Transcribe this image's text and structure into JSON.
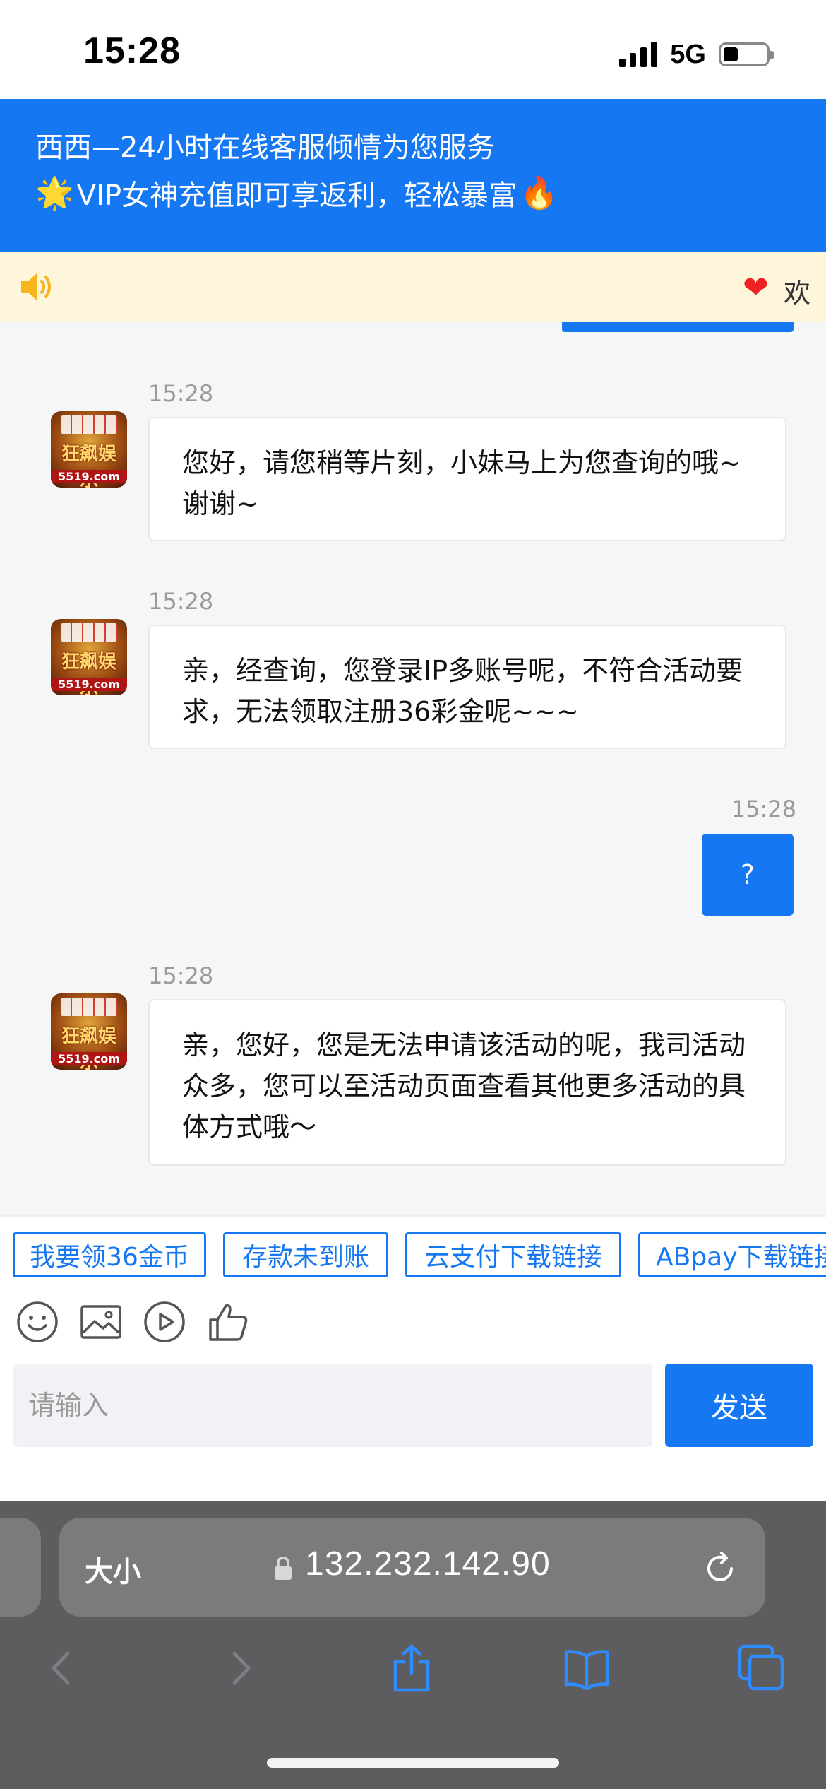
{
  "status_bar": {
    "time": "15:28",
    "network": "5G"
  },
  "header": {
    "title": "西西—24小时在线客服倾情为您服务",
    "promo_text": "VIP女神充值即可享返利，轻松暴富",
    "star_icon": "star-icon",
    "fire_icon": "fire-icon"
  },
  "notice": {
    "icon": "speaker-icon",
    "scroll_text": "欢"
  },
  "chat": {
    "messages": [
      {
        "from": "agent",
        "time": "15:28",
        "text": "您好，请您稍等片刻，小妹马上为您查询的哦~谢谢~"
      },
      {
        "from": "agent",
        "time": "15:28",
        "text": "亲，经查询，您登录IP多账号呢，不符合活动要求，无法领取注册36彩金呢~~~"
      },
      {
        "from": "user",
        "time": "15:28",
        "text": "?"
      },
      {
        "from": "agent",
        "time": "15:28",
        "text": "亲，您好，您是无法申请该活动的呢，我司活动众多，您可以至活动页面查看其他更多活动的具体方式哦～"
      }
    ],
    "avatar": {
      "logo_text": "狂飙娱乐",
      "site": "5519.com"
    }
  },
  "quick_replies": [
    "我要领36金币",
    "存款未到账",
    "云支付下载链接",
    "ABpay下载链接"
  ],
  "toolbar": {
    "icons": [
      "emoji-icon",
      "image-icon",
      "video-icon",
      "thumbs-up-icon"
    ]
  },
  "composer": {
    "placeholder": "请输入",
    "send_label": "发送"
  },
  "browser": {
    "text_size_label": "大小",
    "url": "132.232.142.90"
  },
  "colors": {
    "primary": "#1677f2",
    "notice_bg": "#fdf6da",
    "chrome": "#5d5d60"
  }
}
